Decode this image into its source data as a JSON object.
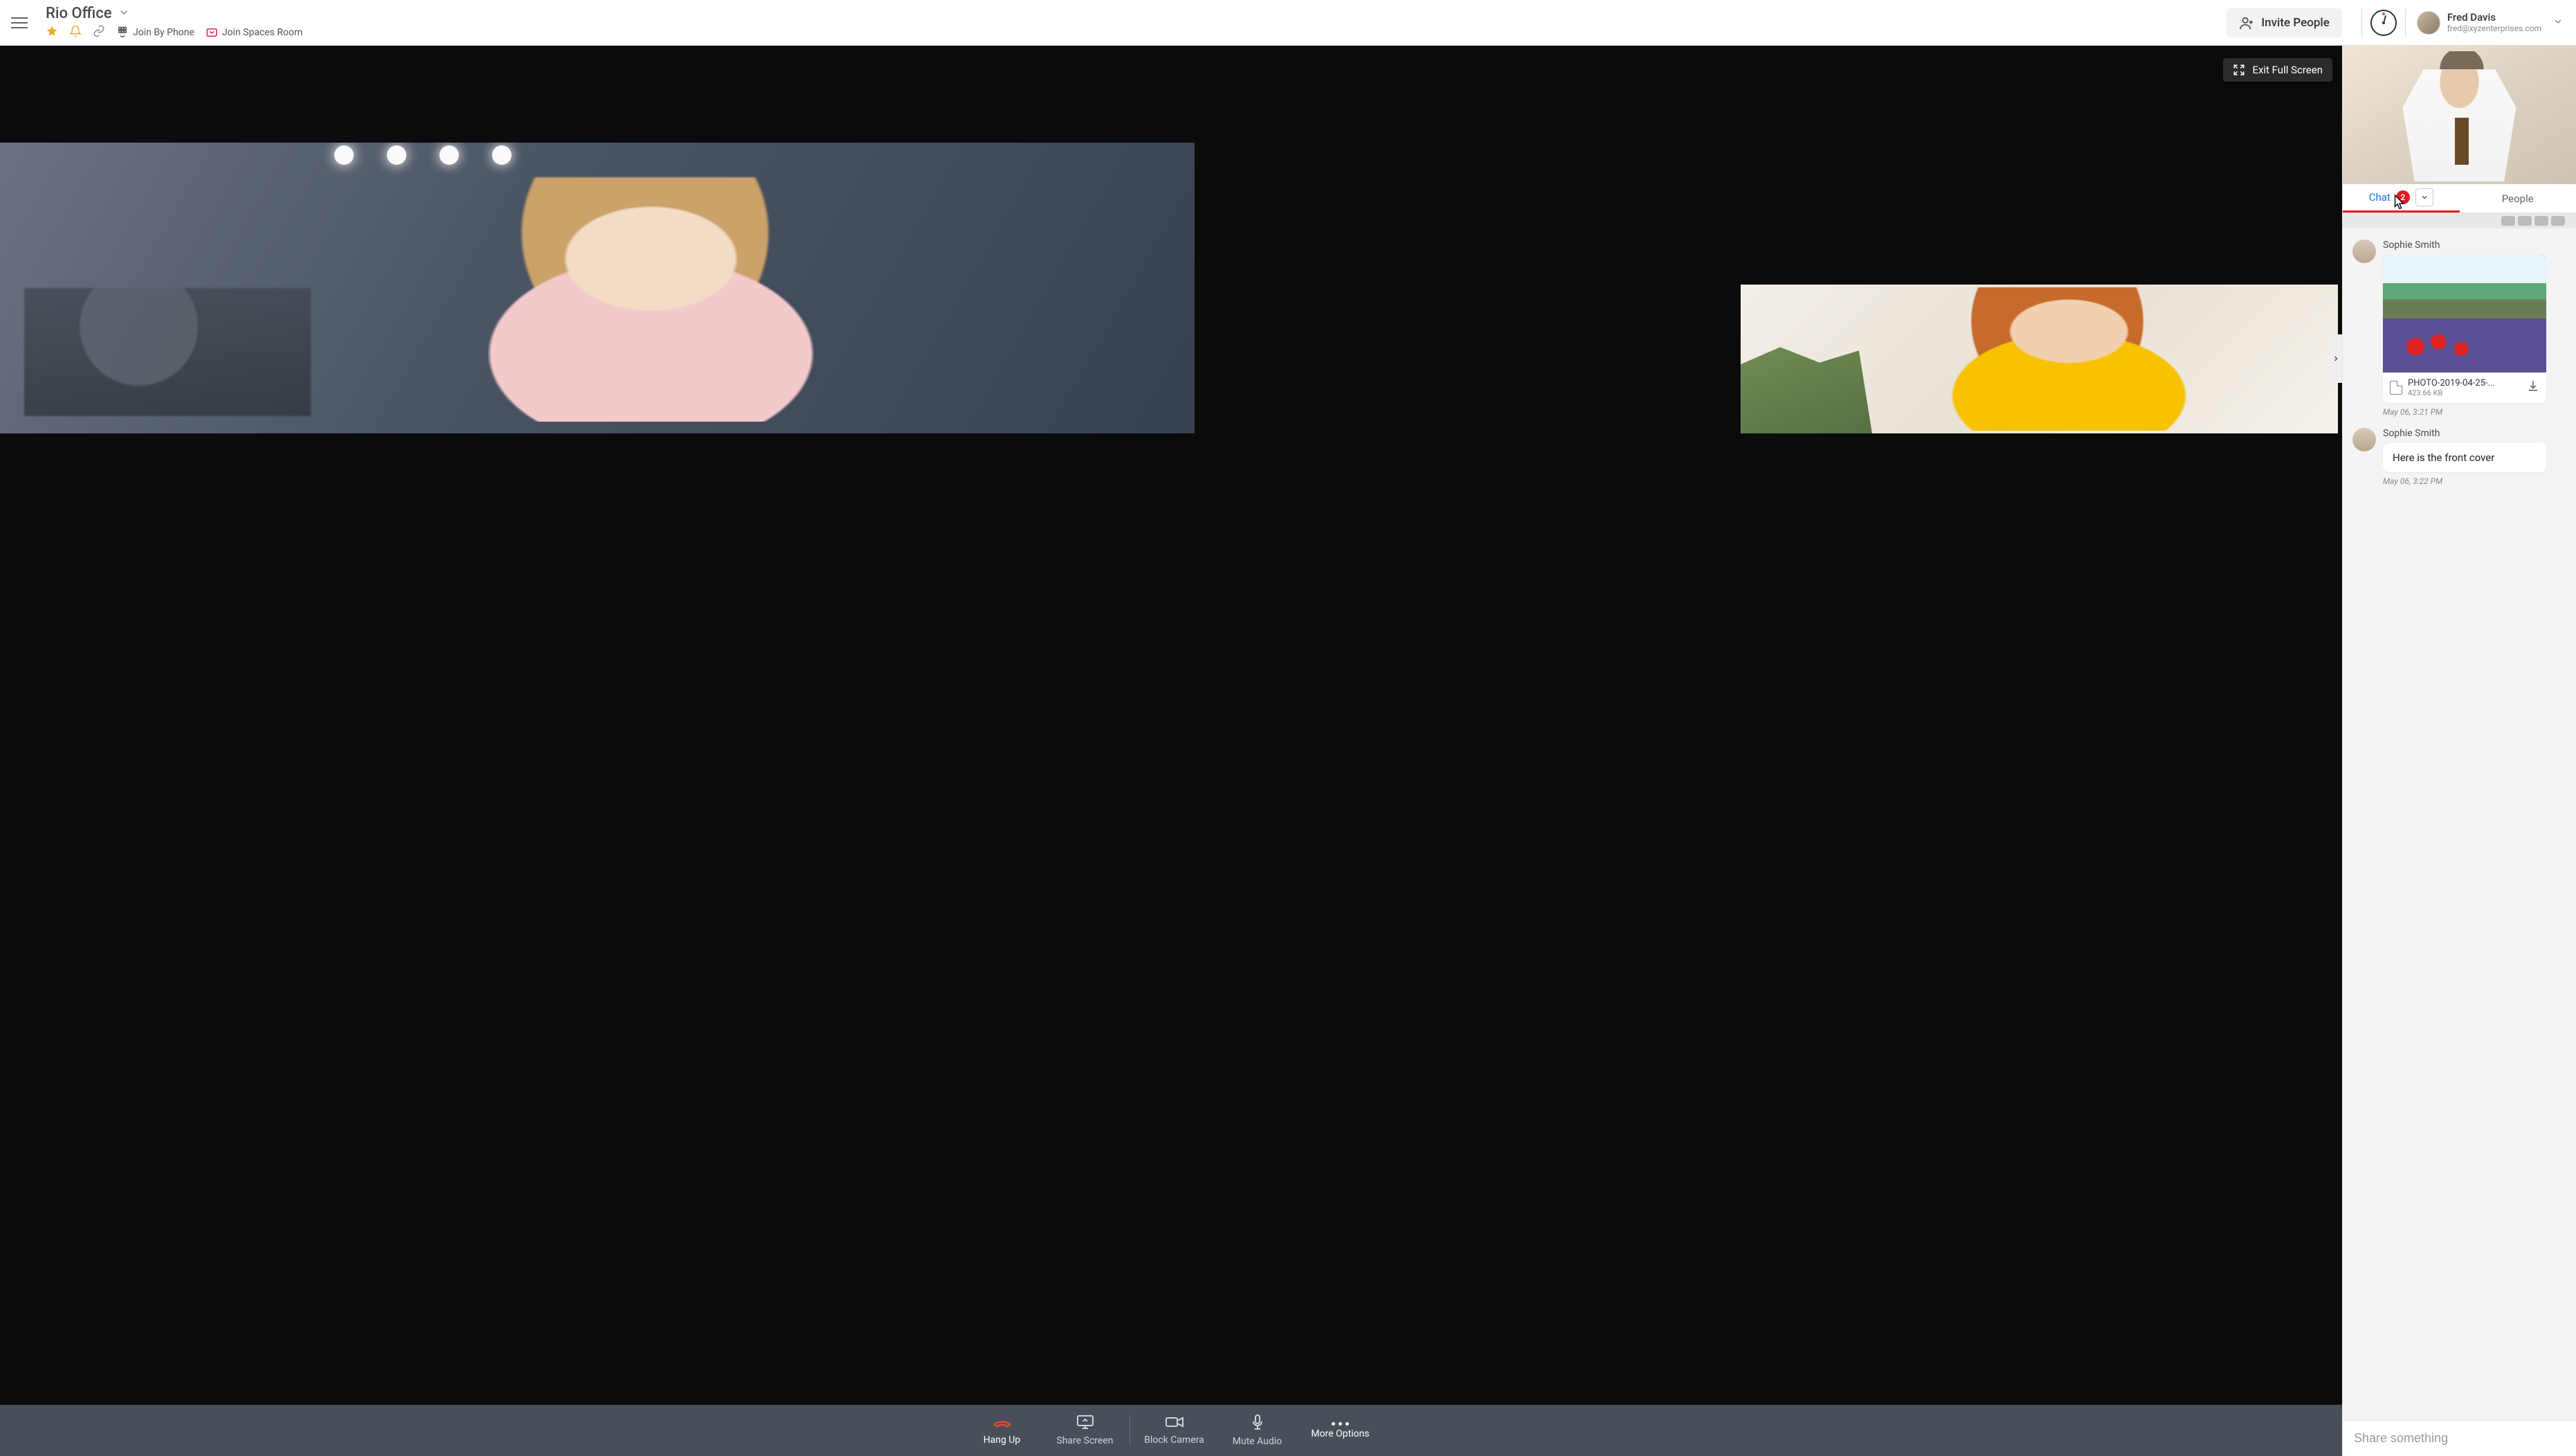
{
  "header": {
    "topic_title": "Rio Office",
    "join_phone_label": "Join By Phone",
    "join_spaces_label": "Join Spaces Room",
    "invite_label": "Invite People",
    "user_name": "Fred Davis",
    "user_email": "fred@xyzenterprises.com"
  },
  "video": {
    "exit_fullscreen_label": "Exit Full Screen"
  },
  "controls": {
    "hang_up": "Hang Up",
    "share_screen": "Share Screen",
    "block_camera": "Block Camera",
    "mute_audio": "Mute Audio",
    "more_options": "More Options"
  },
  "side": {
    "tabs": {
      "chat": "Chat",
      "people": "People",
      "badge": "2"
    },
    "messages": [
      {
        "sender": "Sophie Smith",
        "type": "attachment",
        "file_name": "PHOTO-2019-04-25-...",
        "file_size": "423.66 KB",
        "timestamp": "May 06, 3:21 PM"
      },
      {
        "sender": "Sophie Smith",
        "type": "text",
        "text": "Here is the front cover",
        "timestamp": "May 06, 3:22 PM"
      }
    ],
    "compose_placeholder": "Share something"
  },
  "icons": {
    "hamburger": "hamburger-icon",
    "star": "star-icon",
    "bell": "bell-icon",
    "link": "link-icon",
    "dial": "dial-icon",
    "spaces": "spaces-icon",
    "invite_user": "invite-user-icon",
    "timer": "timer-icon",
    "chevron_down": "chevron-down-icon",
    "exit_fs": "exit-fullscreen-icon",
    "chevron_right": "chevron-right-icon",
    "hang_up": "hang-up-icon",
    "share_screen": "share-screen-icon",
    "camera": "camera-icon",
    "mic": "mic-icon",
    "more": "more-icon",
    "download": "download-icon",
    "file": "file-icon",
    "cursor": "cursor-icon"
  },
  "colors": {
    "accent_blue": "#1273e6",
    "accent_red": "#e31b23",
    "star_orange": "#f5a623",
    "control_bg": "#484f59"
  }
}
